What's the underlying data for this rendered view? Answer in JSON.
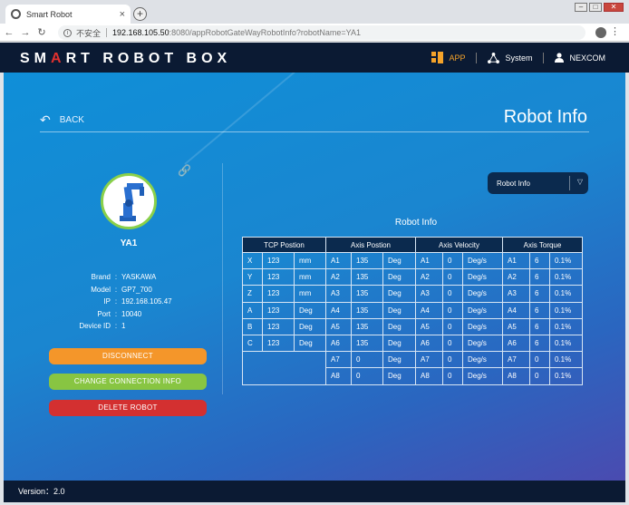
{
  "browser": {
    "tab_title": "Smart Robot",
    "tab_close": "×",
    "new_tab": "+",
    "insecure_label": "不安全",
    "url_host": "192.168.105.50",
    "url_rest": ":8080/appRobotGateWayRobotInfo?robotName=YA1"
  },
  "header": {
    "logo_before": "SM",
    "logo_accent": "A",
    "logo_after": "RT ROBOT BOX",
    "nav": {
      "app": "APP",
      "system": "System",
      "user": "NEXCOM"
    },
    "accent_color": "#f5a32a"
  },
  "page": {
    "back_label": "BACK",
    "title": "Robot Info"
  },
  "robot": {
    "name": "YA1",
    "props": [
      {
        "key": "Brand",
        "value": "YASKAWA"
      },
      {
        "key": "Model",
        "value": "GP7_700"
      },
      {
        "key": "IP",
        "value": "192.168.105.47"
      },
      {
        "key": "Port",
        "value": "10040"
      },
      {
        "key": "Device ID",
        "value": "1"
      }
    ]
  },
  "actions": {
    "disconnect": "DISCONNECT",
    "change": "CHANGE CONNECTION INFO",
    "delete": "DELETE ROBOT"
  },
  "select": {
    "value": "Robot Info"
  },
  "table": {
    "title": "Robot Info",
    "headers": [
      "TCP Postion",
      "Axis Postion",
      "Axis Velocity",
      "Axis Torque"
    ],
    "tcp": [
      [
        "X",
        "123",
        "mm"
      ],
      [
        "Y",
        "123",
        "mm"
      ],
      [
        "Z",
        "123",
        "mm"
      ],
      [
        "A",
        "123",
        "Deg"
      ],
      [
        "B",
        "123",
        "Deg"
      ],
      [
        "C",
        "123",
        "Deg"
      ]
    ],
    "axis_pos": [
      [
        "A1",
        "135",
        "Deg"
      ],
      [
        "A2",
        "135",
        "Deg"
      ],
      [
        "A3",
        "135",
        "Deg"
      ],
      [
        "A4",
        "135",
        "Deg"
      ],
      [
        "A5",
        "135",
        "Deg"
      ],
      [
        "A6",
        "135",
        "Deg"
      ],
      [
        "A7",
        "0",
        "Deg"
      ],
      [
        "A8",
        "0",
        "Deg"
      ]
    ],
    "axis_vel": [
      [
        "A1",
        "0",
        "Deg/s"
      ],
      [
        "A2",
        "0",
        "Deg/s"
      ],
      [
        "A3",
        "0",
        "Deg/s"
      ],
      [
        "A4",
        "0",
        "Deg/s"
      ],
      [
        "A5",
        "0",
        "Deg/s"
      ],
      [
        "A6",
        "0",
        "Deg/s"
      ],
      [
        "A7",
        "0",
        "Deg/s"
      ],
      [
        "A8",
        "0",
        "Deg/s"
      ]
    ],
    "axis_torque": [
      [
        "A1",
        "6",
        "0.1%"
      ],
      [
        "A2",
        "6",
        "0.1%"
      ],
      [
        "A3",
        "6",
        "0.1%"
      ],
      [
        "A4",
        "6",
        "0.1%"
      ],
      [
        "A5",
        "6",
        "0.1%"
      ],
      [
        "A6",
        "6",
        "0.1%"
      ],
      [
        "A7",
        "0",
        "0.1%"
      ],
      [
        "A8",
        "0",
        "0.1%"
      ]
    ]
  },
  "footer": {
    "version": "Version：2.0"
  }
}
